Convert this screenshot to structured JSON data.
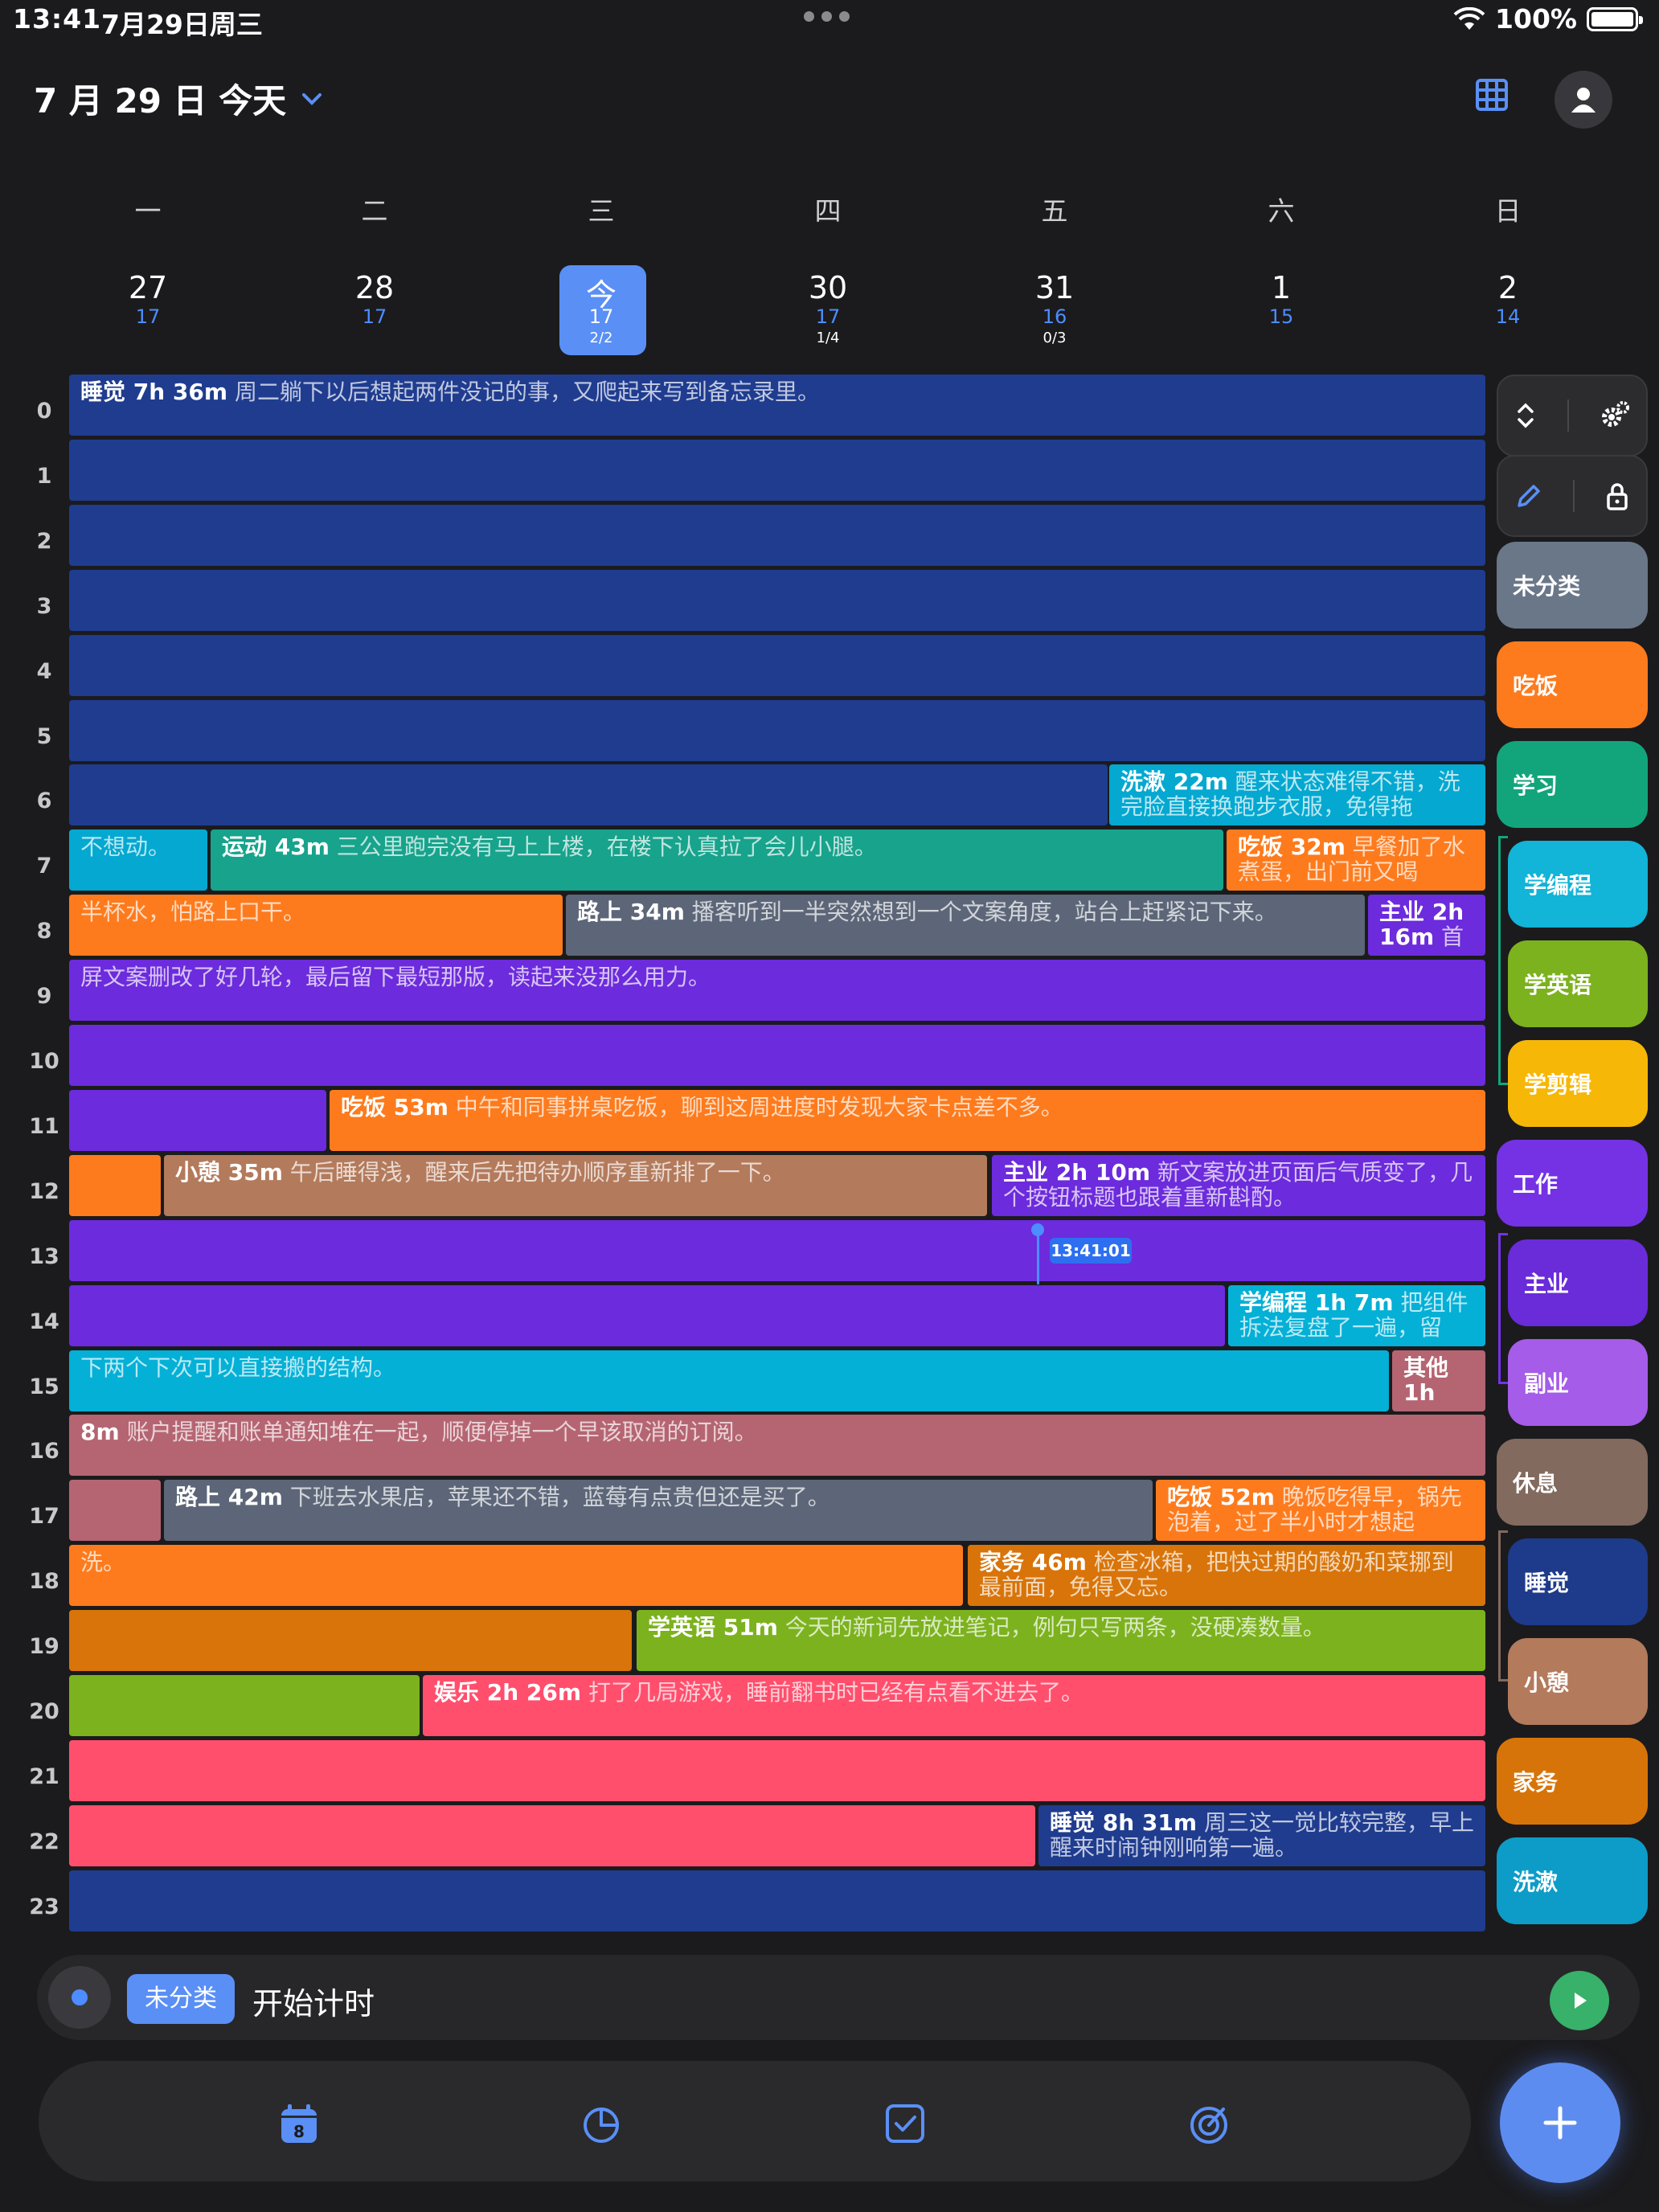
{
  "status": {
    "time": "13:41",
    "date": "7月29日周三",
    "battery": "100%"
  },
  "header": {
    "title": "7 月 29 日 今天"
  },
  "week": {
    "weekdays": [
      "一",
      "二",
      "三",
      "四",
      "五",
      "六",
      "日"
    ],
    "days": [
      {
        "num": "27",
        "sub": "17",
        "frac": ""
      },
      {
        "num": "28",
        "sub": "17",
        "frac": ""
      },
      {
        "num": "今",
        "sub": "17",
        "frac": "2/2"
      },
      {
        "num": "30",
        "sub": "17",
        "frac": "1/4"
      },
      {
        "num": "31",
        "sub": "16",
        "frac": "0/3"
      },
      {
        "num": "1",
        "sub": "15",
        "frac": ""
      },
      {
        "num": "2",
        "sub": "14",
        "frac": ""
      }
    ]
  },
  "hours": [
    "0",
    "1",
    "2",
    "3",
    "4",
    "5",
    "6",
    "7",
    "8",
    "9",
    "10",
    "11",
    "12",
    "13",
    "14",
    "15",
    "16",
    "17",
    "18",
    "19",
    "20",
    "21",
    "22",
    "23"
  ],
  "now_label": "13:41:01",
  "events": [
    {
      "title": "睡觉 7h 36m",
      "note": "周二躺下以后想起两件没记的事，又爬起来写到备忘录里。"
    },
    {
      "title": "洗漱 22m",
      "note": "醒来状态难得不错，洗完脸直接换跑步衣服，免得拖"
    },
    {
      "title": "",
      "note": "不想动。"
    },
    {
      "title": "运动 43m",
      "note": "三公里跑完没有马上上楼，在楼下认真拉了会儿小腿。"
    },
    {
      "title": "吃饭 32m",
      "note": "早餐加了水煮蛋，出门前又喝"
    },
    {
      "title": "",
      "note": "半杯水，怕路上口干。"
    },
    {
      "title": "路上 34m",
      "note": "播客听到一半突然想到一个文案角度，站台上赶紧记下来。"
    },
    {
      "title": "主业 2h 16m",
      "note": "首"
    },
    {
      "title": "",
      "note": "屏文案删改了好几轮，最后留下最短那版，读起来没那么用力。"
    },
    {
      "title": "吃饭 53m",
      "note": "中午和同事拼桌吃饭，聊到这周进度时发现大家卡点差不多。"
    },
    {
      "title": "小憩 35m",
      "note": "午后睡得浅，醒来后先把待办顺序重新排了一下。"
    },
    {
      "title": "主业 2h 10m",
      "note": "新文案放进页面后气质变了，几个按钮标题也跟着重新斟酌。"
    },
    {
      "title": "学编程 1h 7m",
      "note": "把组件拆法复盘了一遍，留"
    },
    {
      "title": "",
      "note": "下两个下次可以直接搬的结构。"
    },
    {
      "title": "其他 1h",
      "note": ""
    },
    {
      "title": "8m",
      "note": "账户提醒和账单通知堆在一起，顺便停掉一个早该取消的订阅。"
    },
    {
      "title": "路上 42m",
      "note": "下班去水果店，苹果还不错，蓝莓有点贵但还是买了。"
    },
    {
      "title": "吃饭 52m",
      "note": "晚饭吃得早，锅先泡着，过了半小时才想起"
    },
    {
      "title": "",
      "note": "洗。"
    },
    {
      "title": "家务 46m",
      "note": "检查冰箱，把快过期的酸奶和菜挪到最前面，免得又忘。"
    },
    {
      "title": "学英语 51m",
      "note": "今天的新词先放进笔记，例句只写两条，没硬凑数量。"
    },
    {
      "title": "娱乐 2h 26m",
      "note": "打了几局游戏，睡前翻书时已经有点看不进去了。"
    },
    {
      "title": "睡觉 8h 31m",
      "note": "周三这一觉比较完整，早上醒来时闹钟刚响第一遍。"
    }
  ],
  "categories": [
    {
      "label": "未分类",
      "color": "#6a7788"
    },
    {
      "label": "吃饭",
      "color": "#fd7b1d"
    },
    {
      "label": "学习",
      "color": "#12a57c"
    },
    {
      "label": "学编程",
      "color": "#12b4d7"
    },
    {
      "label": "学英语",
      "color": "#7cb21e"
    },
    {
      "label": "学剪辑",
      "color": "#f7b706"
    },
    {
      "label": "工作",
      "color": "#7432e4"
    },
    {
      "label": "主业",
      "color": "#6a2bd9"
    },
    {
      "label": "副业",
      "color": "#a55ce8"
    },
    {
      "label": "休息",
      "color": "#826a5e"
    },
    {
      "label": "睡觉",
      "color": "#1e3a8a"
    },
    {
      "label": "小憩",
      "color": "#b37a5c"
    },
    {
      "label": "家务",
      "color": "#d77409"
    },
    {
      "label": "洗漱",
      "color": "#0d9cc8"
    }
  ],
  "timer": {
    "tag": "未分类",
    "text": "开始计时"
  },
  "tabs": {
    "calendar_badge": "8"
  },
  "colors": {
    "accent": "#4d8dff",
    "sleep": "#1f3c8f",
    "work": "#6c2bdc",
    "eat": "#fd7b1d",
    "wash": "#04a8d0",
    "exercise": "#17a38c",
    "commute": "#5c6678",
    "nap": "#b37a5c",
    "code": "#04b0d6",
    "other": "#b56572",
    "chores": "#d87409",
    "english": "#7cb21e",
    "play": "#ff4f6d"
  }
}
